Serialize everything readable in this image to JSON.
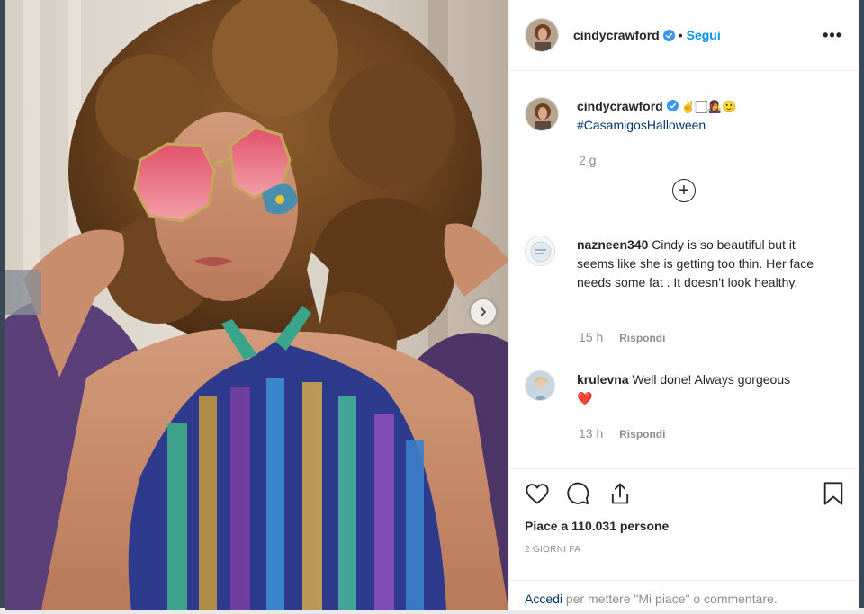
{
  "post": {
    "username": "cindycrawford",
    "follow_label": "Segui",
    "dot": "•",
    "more_label": "•••",
    "caption": {
      "username": "cindycrawford",
      "emojis": "✌️🏻👩‍🎤🙂",
      "hashtag": "#CasamigosHalloween",
      "time": "2 g"
    },
    "load_more_label": "+",
    "comments": [
      {
        "username": "nazneen340",
        "text": "Cindy is so beautiful but it seems like she is getting too thin. Her face needs some fat . It doesn't look healthy.",
        "time": "15 h",
        "reply_label": "Rispondi"
      },
      {
        "username": "krulevna",
        "text": "Well done! Always gorgeous",
        "emoji": "❤️",
        "time": "13 h",
        "reply_label": "Rispondi"
      }
    ],
    "likes": "Piace a 110.031 persone",
    "date": "2 GIORNI FA",
    "login_prompt": {
      "link": "Accedi",
      "text": " per mettere \"Mi piace\" o commentare."
    }
  },
  "icons": [
    "verified-badge-icon",
    "more-options-icon",
    "carousel-next-icon",
    "heart-icon",
    "comment-icon",
    "share-icon",
    "bookmark-icon",
    "plus-circle-icon"
  ],
  "colors": {
    "link_blue": "#0095f6",
    "hashtag": "#00376b",
    "muted": "#8e8e8e",
    "text": "#262626",
    "heart": "#e0245e"
  }
}
